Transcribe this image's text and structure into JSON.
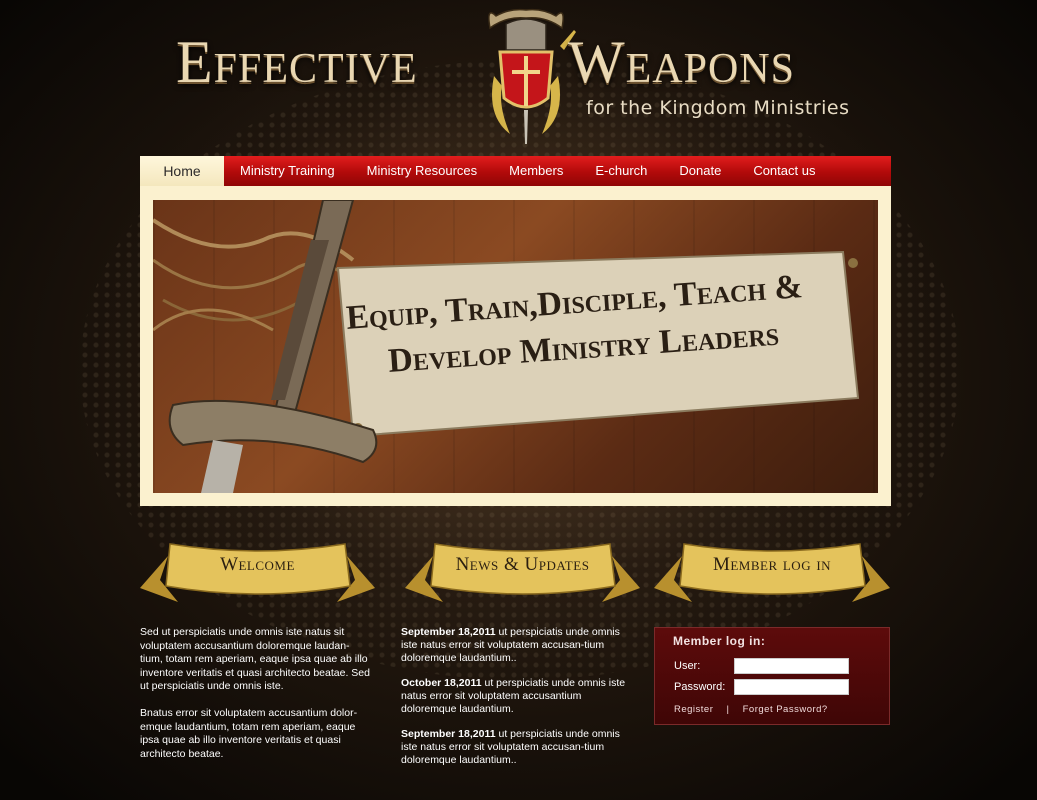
{
  "header": {
    "logo_left": "Effective",
    "logo_right": "Weapons",
    "tagline": "for the Kingdom Ministries"
  },
  "nav": {
    "items": [
      "Home",
      "Ministry Training",
      "Ministry Resources",
      "Members",
      "E-church",
      "Donate",
      "Contact us"
    ]
  },
  "banner": {
    "line1": "Equip, Train,Disciple, Teach &",
    "line2": "Develop Ministry Leaders"
  },
  "sections": {
    "welcome_title": "Welcome",
    "news_title": "News & Updates",
    "login_title": "Member log in"
  },
  "welcome": {
    "p1": "Sed ut perspiciatis unde omnis iste natus  sit voluptatem accusantium doloremque laudan-tium, totam rem aperiam, eaque ipsa quae ab illo inventore veritatis et quasi architecto beatae. Sed ut perspiciatis unde omnis iste.",
    "p2": "Bnatus error sit voluptatem accusantium dolor-emque laudantium, totam rem aperiam, eaque ipsa quae ab illo inventore veritatis et quasi architecto beatae."
  },
  "news": [
    {
      "date": "September 18,2011",
      "text": " ut perspiciatis unde omnis iste natus error sit voluptatem accusan-tium doloremque laudantium.."
    },
    {
      "date": "October 18,2011",
      "text": " ut perspiciatis unde omnis iste natus error sit voluptatem accusantium doloremque laudantium."
    },
    {
      "date": "September 18,2011",
      "text": " ut perspiciatis unde omnis iste natus error sit voluptatem accusan-tium doloremque laudantium.."
    }
  ],
  "login": {
    "title": "Member log in:",
    "user_label": "User:",
    "password_label": "Password:",
    "register": "Register",
    "separator": "|",
    "forgot": "Forget Password?"
  },
  "colors": {
    "nav_red": "#c41212",
    "gold": "#d9b54a",
    "login_bg": "#4e0909"
  }
}
